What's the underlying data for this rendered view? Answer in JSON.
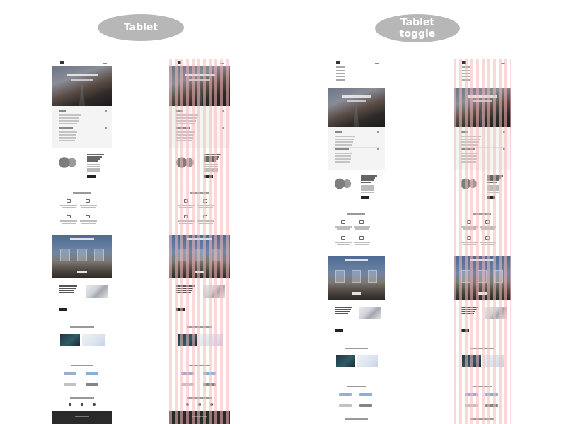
{
  "labels": {
    "tablet": "Tablet",
    "tablet_toggle": "Tablet toggle"
  },
  "colors": {
    "pill_background": "#b7b7b7",
    "pill_text": "#ffffff",
    "grid_overlay": "#f6b9b9",
    "footer": "#2a2a2a"
  },
  "mockups": [
    {
      "name": "tablet",
      "grid": false,
      "menu_open": false
    },
    {
      "name": "tablet-grid",
      "grid": true,
      "menu_open": false
    },
    {
      "name": "tablet-toggle",
      "grid": false,
      "menu_open": true
    },
    {
      "name": "tablet-toggle-grid",
      "grid": true,
      "menu_open": true
    }
  ]
}
